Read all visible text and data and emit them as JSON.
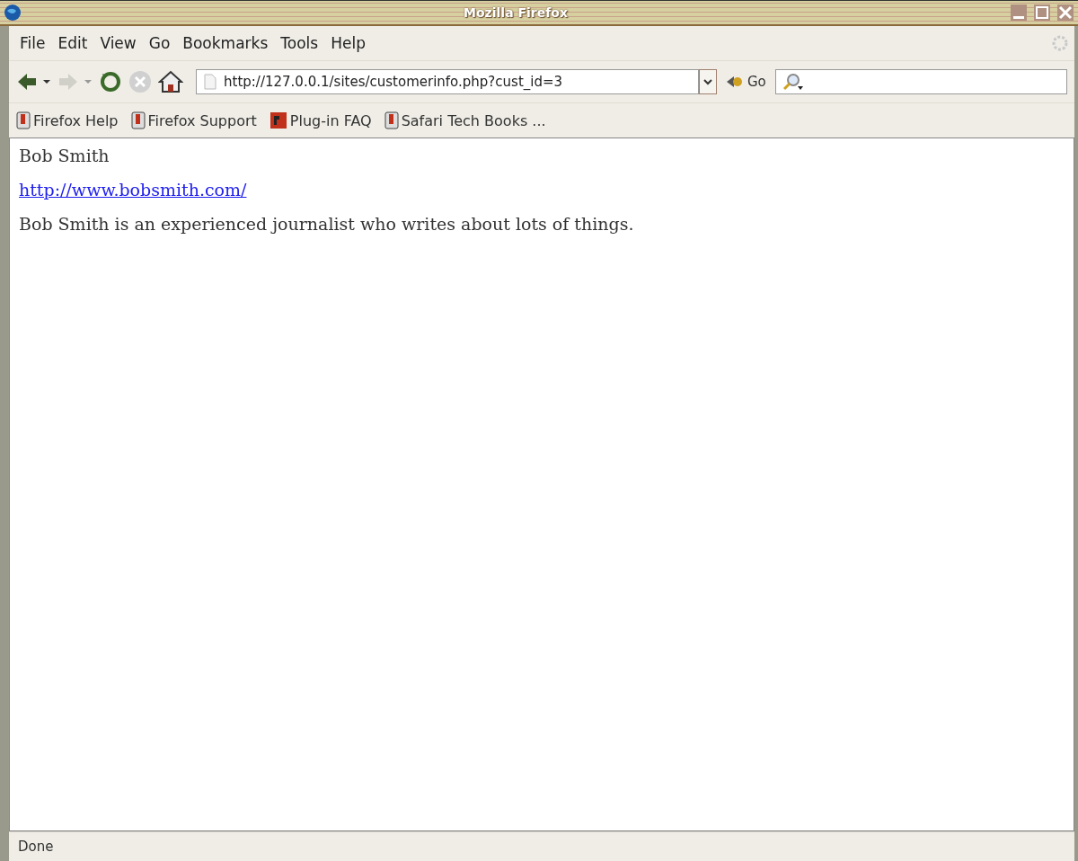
{
  "window": {
    "title": "Mozilla Firefox"
  },
  "menu": [
    "File",
    "Edit",
    "View",
    "Go",
    "Bookmarks",
    "Tools",
    "Help"
  ],
  "navigation": {
    "url": "http://127.0.0.1/sites/customerinfo.php?cust_id=3",
    "go_label": "Go",
    "back_disabled": false,
    "forward_disabled": true,
    "stop_disabled": true
  },
  "bookmarks": [
    {
      "label": "Firefox Help",
      "kind": "book"
    },
    {
      "label": "Firefox Support",
      "kind": "book"
    },
    {
      "label": "Plug-in FAQ",
      "kind": "plugin"
    },
    {
      "label": "Safari Tech Books ...",
      "kind": "book"
    }
  ],
  "content": {
    "name": "Bob Smith",
    "link": "http://www.bobsmith.com/",
    "description": "Bob Smith is an experienced journalist who writes about lots of things."
  },
  "status_bar": "Done"
}
